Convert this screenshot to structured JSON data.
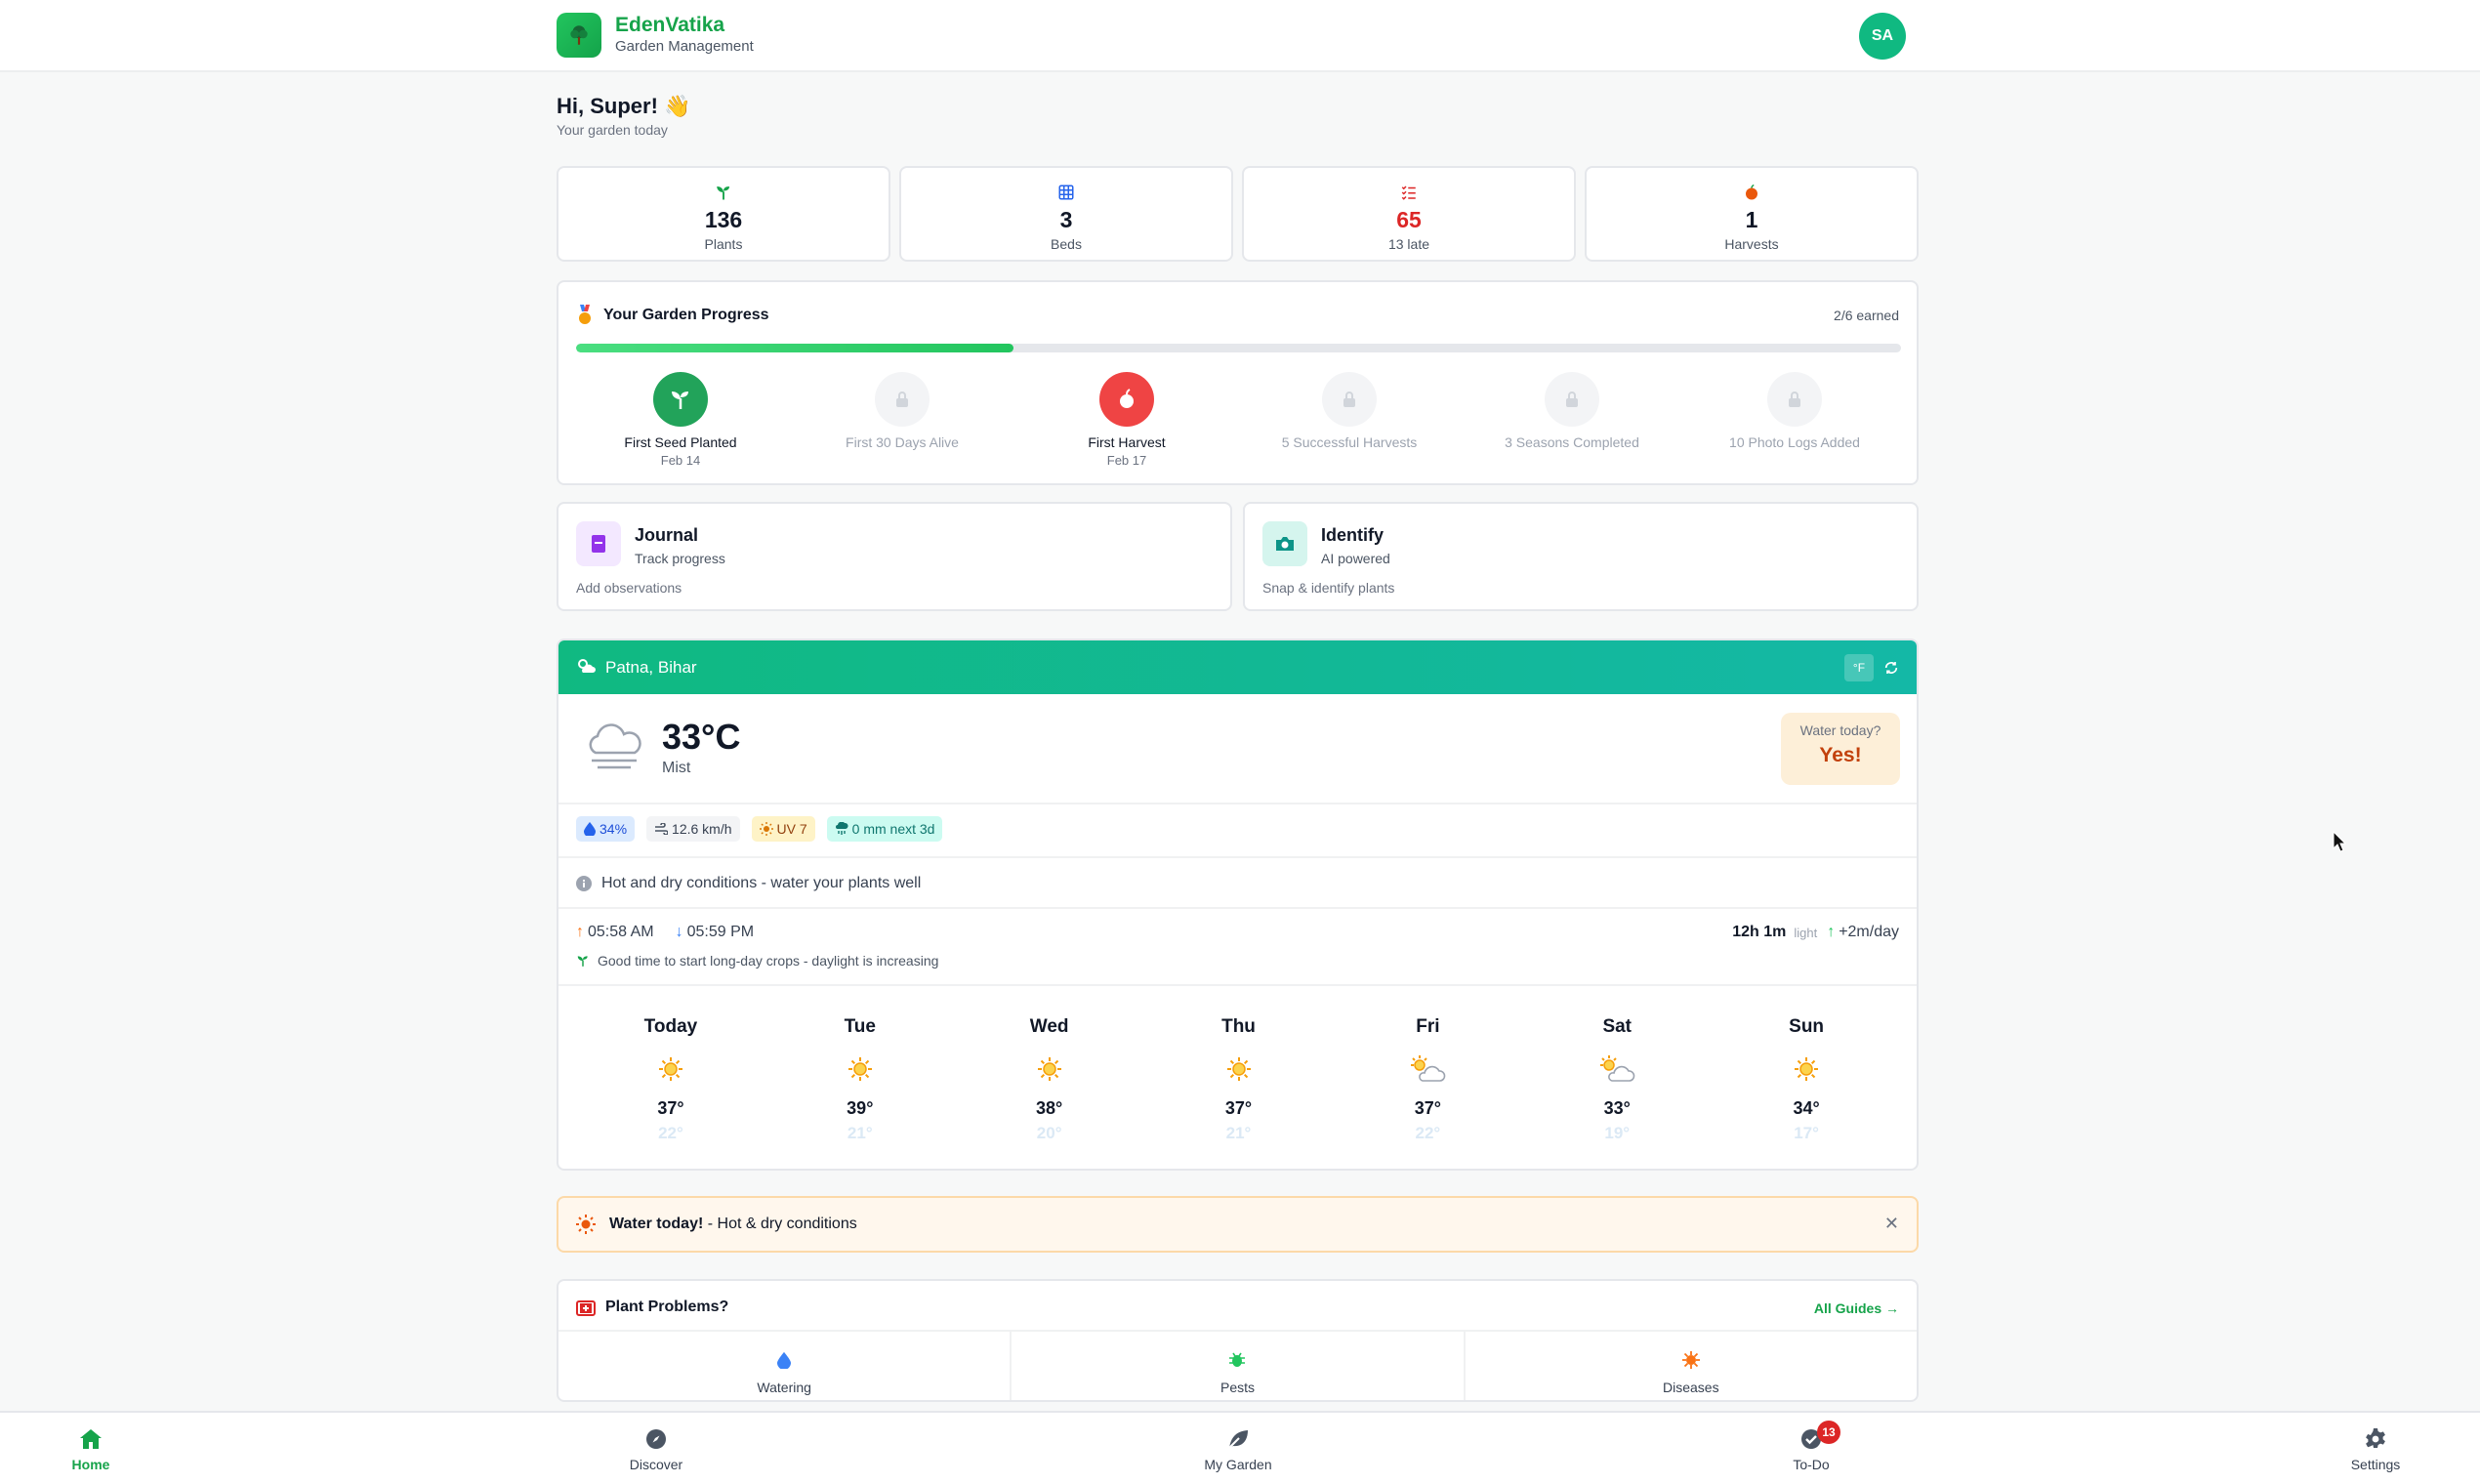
{
  "app": {
    "name": "EdenVatika",
    "subtitle": "Garden Management",
    "avatar_initials": "SA",
    "accent": "#16a34a"
  },
  "greeting": {
    "title": "Hi, Super! 👋",
    "subtitle": "Your garden today"
  },
  "stats": [
    {
      "icon": "sprout-icon",
      "value": "136",
      "label": "Plants",
      "color": "#16a34a"
    },
    {
      "icon": "grid-icon",
      "value": "3",
      "label": "Beds",
      "color": "#2563eb"
    },
    {
      "icon": "checklist-icon",
      "value": "65",
      "label": "13 late",
      "color": "#dc2626"
    },
    {
      "icon": "harvest-icon",
      "value": "1",
      "label": "Harvests",
      "color": "#ea580c"
    }
  ],
  "progress": {
    "title": "Your Garden Progress",
    "earned_label": "2/6 earned",
    "fraction": 0.33,
    "milestones": [
      {
        "name": "First Seed Planted",
        "date": "Feb 14",
        "earned": true,
        "color": "#22a35a",
        "icon": "sprout-icon"
      },
      {
        "name": "First 30 Days Alive",
        "date": "",
        "earned": false,
        "icon": "lock-icon"
      },
      {
        "name": "First Harvest",
        "date": "Feb 17",
        "earned": true,
        "color": "#ef4444",
        "icon": "apple-icon"
      },
      {
        "name": "5 Successful Harvests",
        "date": "",
        "earned": false,
        "icon": "lock-icon"
      },
      {
        "name": "3 Seasons Completed",
        "date": "",
        "earned": false,
        "icon": "lock-icon"
      },
      {
        "name": "10 Photo Logs Added",
        "date": "",
        "earned": false,
        "icon": "lock-icon"
      }
    ]
  },
  "features": [
    {
      "title": "Journal",
      "subtitle": "Track progress",
      "description": "Add observations",
      "icon": "book-icon"
    },
    {
      "title": "Identify",
      "subtitle": "AI powered",
      "description": "Snap & identify plants",
      "icon": "camera-icon"
    }
  ],
  "weather": {
    "location": "Patna, Bihar",
    "unit_toggle": "°F",
    "temperature": "33°C",
    "condition": "Mist",
    "water_question": "Water today?",
    "water_answer": "Yes!",
    "chips": [
      {
        "text": "34%",
        "icon": "drop-icon"
      },
      {
        "text": "12.6 km/h",
        "icon": "wind-icon"
      },
      {
        "text": "UV 7",
        "icon": "sun-icon"
      },
      {
        "text": "0 mm next 3d",
        "icon": "rain-icon"
      }
    ],
    "advice": "Hot and dry conditions - water your plants well",
    "sunrise": "05:58 AM",
    "sunset": "05:59 PM",
    "daylight": "12h 1m",
    "daylight_label": "light",
    "daylight_change": "+2m/day",
    "tip": "Good time to start long-day crops - daylight is increasing",
    "forecast": [
      {
        "day": "Today",
        "high": "37°",
        "low": "22°",
        "icon": "sun-icon"
      },
      {
        "day": "Tue",
        "high": "39°",
        "low": "21°",
        "icon": "sun-icon"
      },
      {
        "day": "Wed",
        "high": "38°",
        "low": "20°",
        "icon": "sun-icon"
      },
      {
        "day": "Thu",
        "high": "37°",
        "low": "21°",
        "icon": "sun-icon"
      },
      {
        "day": "Fri",
        "high": "37°",
        "low": "22°",
        "icon": "partly-cloudy-icon"
      },
      {
        "day": "Sat",
        "high": "33°",
        "low": "19°",
        "icon": "partly-cloudy-icon"
      },
      {
        "day": "Sun",
        "high": "34°",
        "low": "17°",
        "icon": "sun-icon"
      }
    ]
  },
  "alert": {
    "bold": "Water today!",
    "text": " - Hot & dry conditions"
  },
  "problems": {
    "title": "Plant Problems?",
    "link": "All Guides →",
    "items": [
      {
        "label": "Watering",
        "icon": "drop-icon",
        "color": "#3b82f6"
      },
      {
        "label": "Pests",
        "icon": "bug-icon",
        "color": "#22c55e"
      },
      {
        "label": "Diseases",
        "icon": "virus-icon",
        "color": "#f97316"
      }
    ]
  },
  "nav": [
    {
      "label": "Home",
      "icon": "home-icon",
      "active": true
    },
    {
      "label": "Discover",
      "icon": "compass-icon"
    },
    {
      "label": "My Garden",
      "icon": "leaf-icon"
    },
    {
      "label": "To-Do",
      "icon": "check-circle-icon",
      "badge": "13"
    },
    {
      "label": "Settings",
      "icon": "gear-icon"
    }
  ]
}
